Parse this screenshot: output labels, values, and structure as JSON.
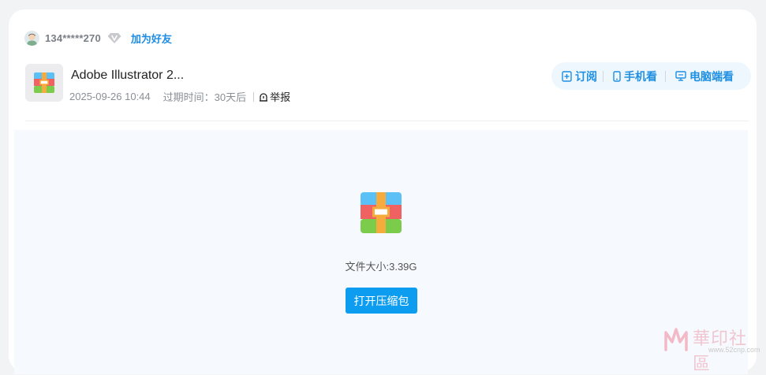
{
  "user": {
    "username": "134*****270",
    "add_friend_label": "加为好友"
  },
  "file": {
    "title": "Adobe Illustrator 2...",
    "date": "2025-09-26 10:44",
    "expire_text": "过期时间：30天后",
    "report_label": "举报"
  },
  "actions": {
    "subscribe_label": "订阅",
    "mobile_label": "手机看",
    "pc_label": "电脑端看"
  },
  "preview": {
    "size_text": "文件大小:3.39G",
    "open_button_label": "打开压缩包"
  },
  "watermark": {
    "brand_text": "華印社區",
    "url_text": "www.52cnp.com"
  },
  "icons": {
    "avatar": "user-avatar-icon",
    "vip": "diamond-v-icon",
    "archive": "archive-icon",
    "report": "report-icon",
    "subscribe": "subscribe-icon",
    "mobile": "mobile-icon",
    "pc": "monitor-icon"
  },
  "colors": {
    "accent": "#1d8de4",
    "button": "#0d9df0",
    "actions_bg": "#eef7fe",
    "preview_bg": "#f6f9fd"
  }
}
